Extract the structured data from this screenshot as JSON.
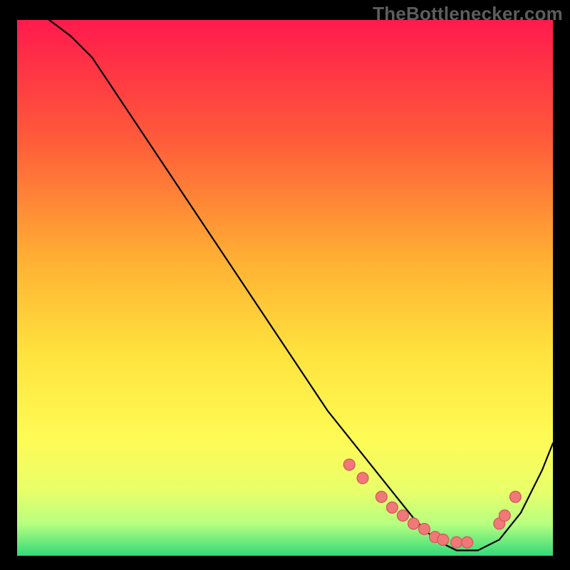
{
  "watermark": "TheBottlenecker.com",
  "colors": {
    "background": "#000000",
    "watermark": "#5d5d5d",
    "curve": "#000000",
    "marker_fill": "#f07878",
    "marker_stroke": "#d65a5a",
    "gradient": {
      "top": "#ff1a4d",
      "upper": "#ff5a3a",
      "mid_high": "#ffb133",
      "mid": "#ffe23d",
      "mid_low": "#fffb55",
      "low": "#e8ff6a",
      "band": "#b8ff80",
      "bottom": "#33d97a"
    }
  },
  "chart_data": {
    "type": "line",
    "title": "",
    "xlabel": "",
    "ylabel": "",
    "xlim": [
      0,
      100
    ],
    "ylim": [
      0,
      100
    ],
    "grid": false,
    "legend": false,
    "series": [
      {
        "name": "bottleneck-curve",
        "x": [
          6,
          10,
          14,
          18,
          22,
          26,
          30,
          34,
          38,
          42,
          46,
          50,
          54,
          58,
          62,
          66,
          70,
          74,
          78,
          82,
          86,
          90,
          94,
          98,
          100
        ],
        "y": [
          100,
          97,
          93,
          87,
          81,
          75,
          69,
          63,
          57,
          51,
          45,
          39,
          33,
          27,
          22,
          17,
          12,
          7,
          3,
          1,
          1,
          3,
          8,
          16,
          21
        ]
      }
    ],
    "markers": {
      "name": "highlight-points",
      "x": [
        62,
        64.5,
        68,
        70,
        72,
        74,
        76,
        78,
        79.5,
        82,
        84,
        90,
        91,
        93
      ],
      "y": [
        17,
        14.5,
        11,
        9,
        7.5,
        6,
        5,
        3.5,
        3,
        2.5,
        2.5,
        6,
        7.5,
        11
      ]
    }
  }
}
